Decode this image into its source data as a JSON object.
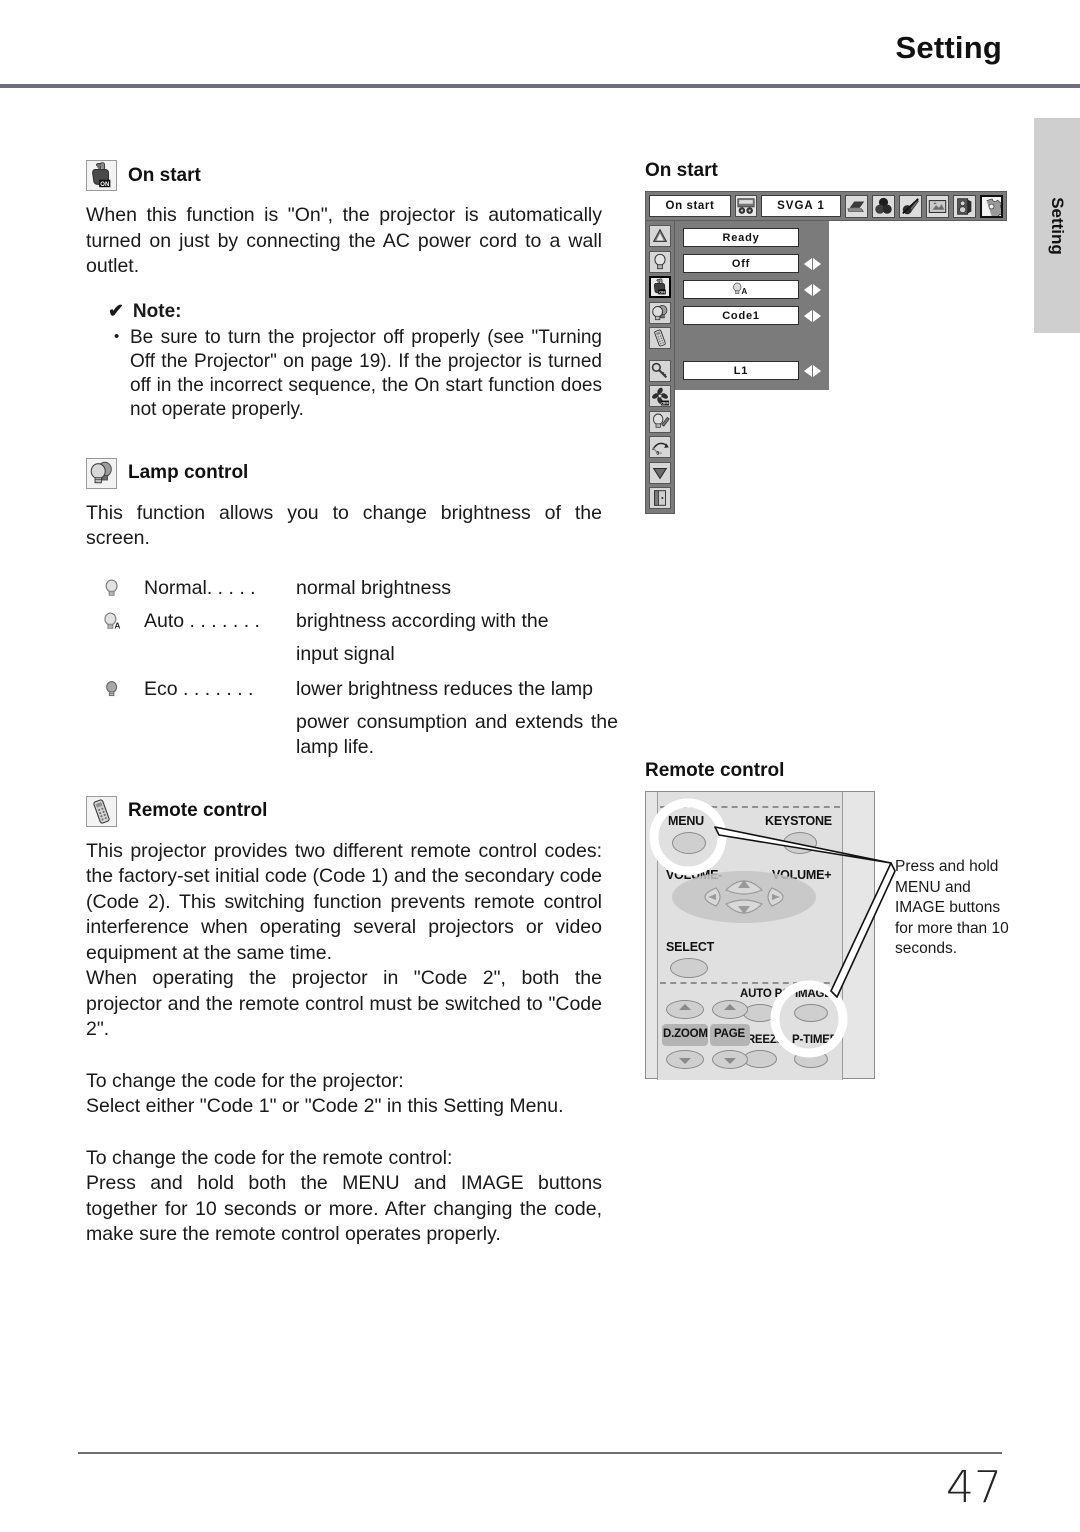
{
  "header": {
    "title": "Setting"
  },
  "side_tab": {
    "label": "Setting"
  },
  "footer": {
    "page_number": "47"
  },
  "left_column": {
    "on_start": {
      "icon": "hand-on-icon",
      "heading": "On start",
      "body": "When this function is \"On\", the projector is automatically turned on just by connecting the AC power cord to a wall outlet.",
      "note": {
        "check": "✔",
        "label": "Note:",
        "items": [
          "Be sure to turn the projector off properly (see \"Turning Off the Projector\" on page 19).  If the projector is turned off in the incorrect sequence, the On start function does not operate properly."
        ]
      }
    },
    "lamp_control": {
      "icon": "lamp-control-icon",
      "heading": "Lamp control",
      "body": "This function allows you to change brightness of the screen.",
      "modes": [
        {
          "icon": "lamp-normal-icon",
          "name": "Normal. . . . .",
          "desc": "normal brightness",
          "desc_cont": ""
        },
        {
          "icon": "lamp-auto-icon",
          "name": "Auto . . . . . . .",
          "desc": "brightness according with the",
          "desc_cont": "input  signal"
        },
        {
          "icon": "lamp-eco-icon",
          "name": "Eco  . . . . . . .",
          "desc": "lower brightness reduces the lamp",
          "desc_cont": "power consumption and extends the lamp life."
        }
      ]
    },
    "remote_control": {
      "icon": "remote-control-icon",
      "heading": "Remote control",
      "paragraphs": [
        "This projector provides two different remote control codes: the factory-set initial code (Code 1) and the secondary code (Code 2).  This switching function prevents remote control interference when operating several projectors or video equipment at the same time.",
        "When operating the projector in \"Code 2\", both the projector and the remote control must be switched to \"Code 2\".",
        "To change the code for the projector:",
        "Select either \"Code 1\" or \"Code 2\" in this Setting Menu.",
        "To change the code for the remote control:",
        "Press and hold both the MENU and IMAGE buttons together for 10 seconds or more.  After changing the code, make sure the  remote control operates properly."
      ]
    }
  },
  "right_column": {
    "on_start": {
      "heading": "On start",
      "osd": {
        "menu_title": "On start",
        "mini_icon": "input-source-icon",
        "input_value": "SVGA 1",
        "category_icons": [
          "computer-icon",
          "color-adjust-icon",
          "sound-mute-icon",
          "screen-icon",
          "sound-speaker-icon",
          "setting-gear-icon"
        ],
        "selected_category_index": 5,
        "side_icons": [
          "language-icon",
          "lamp-icon",
          "hand-on-icon",
          "lamp-control-icon",
          "remote-control-icon",
          "key-lock-icon",
          "fan-off-icon",
          "lamp-counter-icon",
          "factory-default-icon",
          "down-arrow-icon",
          "quit-icon"
        ],
        "selected_side_index": 2,
        "rows": [
          {
            "value": "Ready",
            "has_arrows": false,
            "icon": ""
          },
          {
            "value": "Off",
            "has_arrows": true,
            "icon": ""
          },
          {
            "value": "",
            "has_arrows": true,
            "icon": "lamp-auto-icon"
          },
          {
            "value": "Code1",
            "has_arrows": true,
            "icon": ""
          },
          {
            "value": "L1",
            "has_arrows": true,
            "icon": ""
          }
        ]
      }
    },
    "remote_control": {
      "heading": "Remote control",
      "remote_buttons": {
        "menu": "MENU",
        "keystone": "KEYSTONE",
        "volume_minus": "VOLUME-",
        "volume_plus": "VOLUME+",
        "select": "SELECT",
        "auto_pc": "AUTO PC",
        "image": "IMAGE",
        "d_zoom": "D.ZOOM",
        "page": "PAGE",
        "freeze": "FREEZE",
        "p_timer": "P-TIMER"
      },
      "callout": "Press and hold MENU and IMAGE buttons for more than 10 seconds."
    }
  },
  "colors": {
    "osd_gray": "#7b7b7b",
    "side_tab_gray": "#cfcfcf",
    "rule_blue_gray": "#6f6f80",
    "remote_body": "#e0e0e0",
    "remote_button": "#cfcfcf"
  }
}
